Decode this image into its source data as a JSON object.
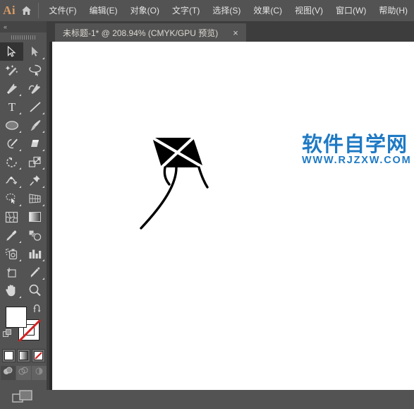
{
  "app": {
    "logo_text": "Ai",
    "home_icon": "home-icon"
  },
  "menubar": {
    "items": [
      {
        "label": "文件(F)",
        "name": "menu-file"
      },
      {
        "label": "编辑(E)",
        "name": "menu-edit"
      },
      {
        "label": "对象(O)",
        "name": "menu-object"
      },
      {
        "label": "文字(T)",
        "name": "menu-type"
      },
      {
        "label": "选择(S)",
        "name": "menu-select"
      },
      {
        "label": "效果(C)",
        "name": "menu-effect"
      },
      {
        "label": "视图(V)",
        "name": "menu-view"
      },
      {
        "label": "窗口(W)",
        "name": "menu-window"
      },
      {
        "label": "帮助(H)",
        "name": "menu-help"
      }
    ]
  },
  "tabbar": {
    "document_title": "未标题-1* @ 208.94% (CMYK/GPU 预览)",
    "close_label": "×",
    "zoom_level": "208.94%",
    "color_mode": "CMYK",
    "preview_mode": "GPU 预览"
  },
  "toolbar": {
    "collapse_label": "«",
    "tools": [
      {
        "name": "selection-tool",
        "icon": "arrow-solid-icon",
        "active": true,
        "corner": false
      },
      {
        "name": "direct-selection-tool",
        "icon": "arrow-white-icon",
        "active": false,
        "corner": true
      },
      {
        "name": "magic-wand-tool",
        "icon": "magic-wand-icon",
        "active": false,
        "corner": false
      },
      {
        "name": "lasso-tool",
        "icon": "lasso-icon",
        "active": false,
        "corner": false
      },
      {
        "name": "pen-tool",
        "icon": "pen-icon",
        "active": false,
        "corner": true
      },
      {
        "name": "curvature-tool",
        "icon": "curvature-icon",
        "active": false,
        "corner": false
      },
      {
        "name": "type-tool",
        "icon": "type-icon",
        "active": false,
        "corner": true
      },
      {
        "name": "line-segment-tool",
        "icon": "line-icon",
        "active": false,
        "corner": true
      },
      {
        "name": "ellipse-tool",
        "icon": "ellipse-icon",
        "active": false,
        "corner": true
      },
      {
        "name": "paintbrush-tool",
        "icon": "paintbrush-icon",
        "active": false,
        "corner": true
      },
      {
        "name": "shaper-tool",
        "icon": "shaper-pencil-icon",
        "active": false,
        "corner": true
      },
      {
        "name": "eraser-tool",
        "icon": "eraser-icon",
        "active": false,
        "corner": true
      },
      {
        "name": "rotate-tool",
        "icon": "rotate-icon",
        "active": false,
        "corner": true
      },
      {
        "name": "scale-tool",
        "icon": "scale-icon",
        "active": false,
        "corner": true
      },
      {
        "name": "width-tool",
        "icon": "width-icon",
        "active": false,
        "corner": true
      },
      {
        "name": "free-transform-tool",
        "icon": "pushpin-icon",
        "active": false,
        "corner": true
      },
      {
        "name": "shape-builder-tool",
        "icon": "shape-builder-icon",
        "active": false,
        "corner": true
      },
      {
        "name": "perspective-grid-tool",
        "icon": "perspective-grid-icon",
        "active": false,
        "corner": true
      },
      {
        "name": "mesh-tool",
        "icon": "mesh-icon",
        "active": false,
        "corner": false
      },
      {
        "name": "gradient-tool",
        "icon": "gradient-icon",
        "active": false,
        "corner": false
      },
      {
        "name": "eyedropper-tool",
        "icon": "eyedropper-icon",
        "active": false,
        "corner": true
      },
      {
        "name": "blend-tool",
        "icon": "blend-icon",
        "active": false,
        "corner": false
      },
      {
        "name": "symbol-sprayer-tool",
        "icon": "symbol-sprayer-icon",
        "active": false,
        "corner": true
      },
      {
        "name": "column-graph-tool",
        "icon": "bar-chart-icon",
        "active": false,
        "corner": true
      },
      {
        "name": "artboard-tool",
        "icon": "artboard-icon",
        "active": false,
        "corner": false
      },
      {
        "name": "slice-tool",
        "icon": "slice-knife-icon",
        "active": false,
        "corner": true
      },
      {
        "name": "hand-tool",
        "icon": "hand-icon",
        "active": false,
        "corner": true
      },
      {
        "name": "zoom-tool",
        "icon": "magnifier-icon",
        "active": false,
        "corner": false
      }
    ],
    "fill_color": "#ffffff",
    "stroke_color": "#ffffff",
    "swap_icon": "swap-fill-stroke-icon",
    "default_icon": "default-fill-stroke-icon",
    "color_modes": [
      {
        "name": "color-mode-button",
        "icon": "solid-color-icon",
        "active": true
      },
      {
        "name": "gradient-mode-button",
        "icon": "gradient-swatch-icon",
        "active": false
      },
      {
        "name": "none-mode-button",
        "icon": "none-slash-icon",
        "active": false
      }
    ],
    "draw_modes": [
      {
        "name": "draw-normal-button",
        "icon": "draw-normal-icon",
        "active": true
      },
      {
        "name": "draw-behind-button",
        "icon": "draw-behind-icon",
        "active": false
      },
      {
        "name": "draw-inside-button",
        "icon": "draw-inside-icon",
        "active": false
      }
    ],
    "screen_mode": {
      "name": "change-screen-mode-button",
      "icon": "screen-mode-icon"
    }
  },
  "canvas": {
    "artwork_name": "kite-illustration",
    "artwork_fill": "#000000",
    "background": "#ffffff"
  },
  "watermark": {
    "chinese_text": "软件自学网",
    "url_text": "WWW.RJZXW.COM",
    "color": "#1f7ac4"
  }
}
